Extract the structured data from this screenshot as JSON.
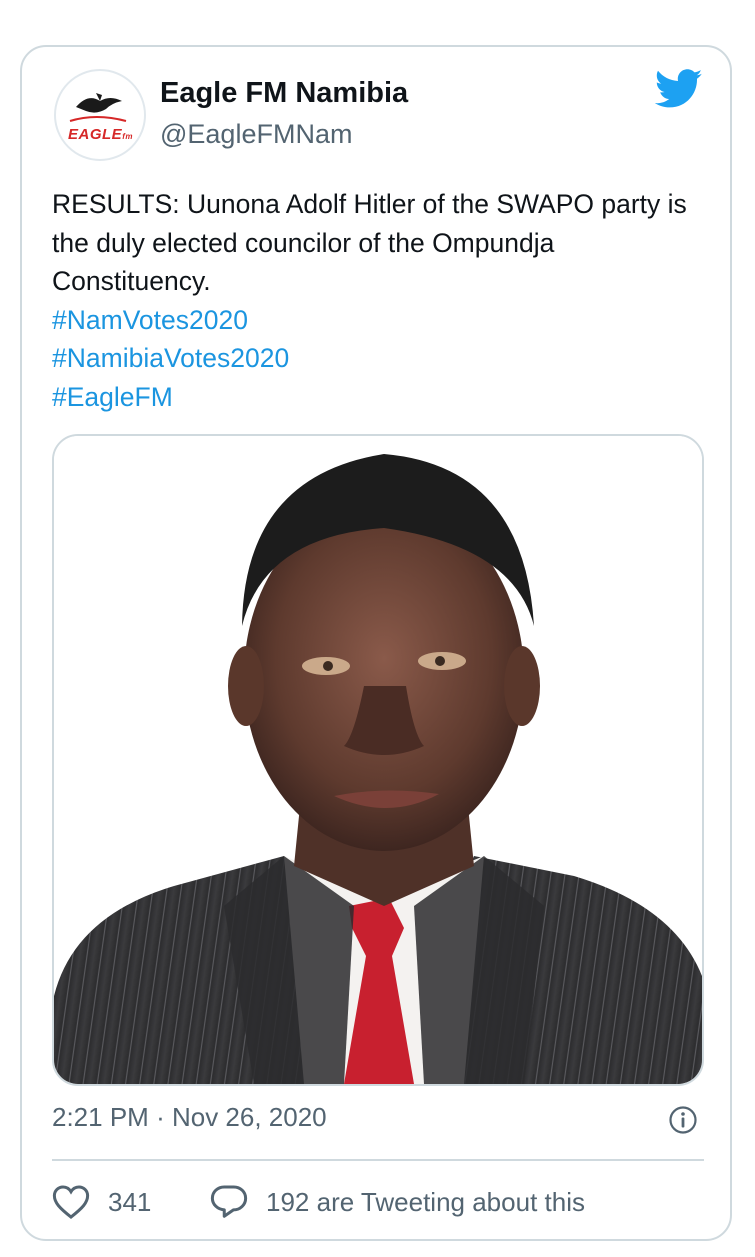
{
  "account": {
    "name": "Eagle FM Namibia",
    "handle": "@EagleFMNam",
    "avatar_word": "EAGLE",
    "avatar_suffix": "fm"
  },
  "tweet": {
    "text": "RESULTS: Uunona Adolf Hitler of the SWAPO party is the duly elected councilor of the Ompundja Constituency.",
    "hashtags": [
      "#NamVotes2020",
      "#NamibiaVotes2020",
      "#EagleFM"
    ],
    "time": "2:21 PM",
    "separator": "·",
    "date": "Nov 26, 2020"
  },
  "stats": {
    "likes": "341",
    "tweeting": "192 are Tweeting about this"
  },
  "icons": {
    "brand": "twitter-bird-icon",
    "info": "info-icon",
    "like": "heart-icon",
    "reply": "speech-bubble-icon"
  },
  "colors": {
    "accent": "#1da1f2",
    "link": "#1b95e0",
    "muted": "#536471",
    "border": "#cfd9de",
    "tie": "#c8202f"
  }
}
